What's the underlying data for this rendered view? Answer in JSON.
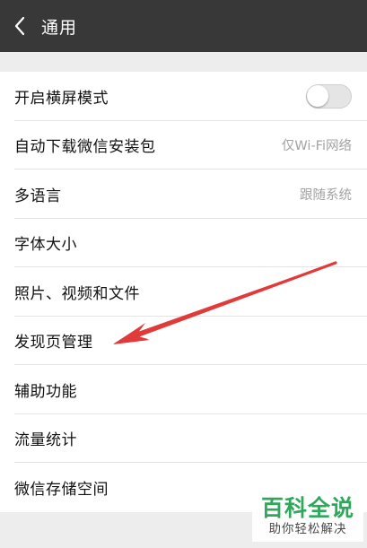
{
  "header": {
    "title": "通用"
  },
  "settings": {
    "items": [
      {
        "label": "开启横屏模式",
        "value": ""
      },
      {
        "label": "自动下载微信安装包",
        "value": "仅Wi-Fi网络"
      },
      {
        "label": "多语言",
        "value": "跟随系统"
      },
      {
        "label": "字体大小",
        "value": ""
      },
      {
        "label": "照片、视频和文件",
        "value": ""
      },
      {
        "label": "发现页管理",
        "value": ""
      },
      {
        "label": "辅助功能",
        "value": ""
      },
      {
        "label": "流量统计",
        "value": ""
      },
      {
        "label": "微信存储空间",
        "value": ""
      }
    ],
    "landscape_toggle_on": false
  },
  "watermark": {
    "main": "百科全说",
    "sub": "助你轻松解决"
  },
  "colors": {
    "titlebar": "#383838",
    "background": "#ededed",
    "annotation_arrow": "#e03a3a",
    "watermark_green": "#2fa85c"
  },
  "icons": {
    "back": "chevron-left-icon",
    "annotation": "red-arrow-annotation"
  }
}
